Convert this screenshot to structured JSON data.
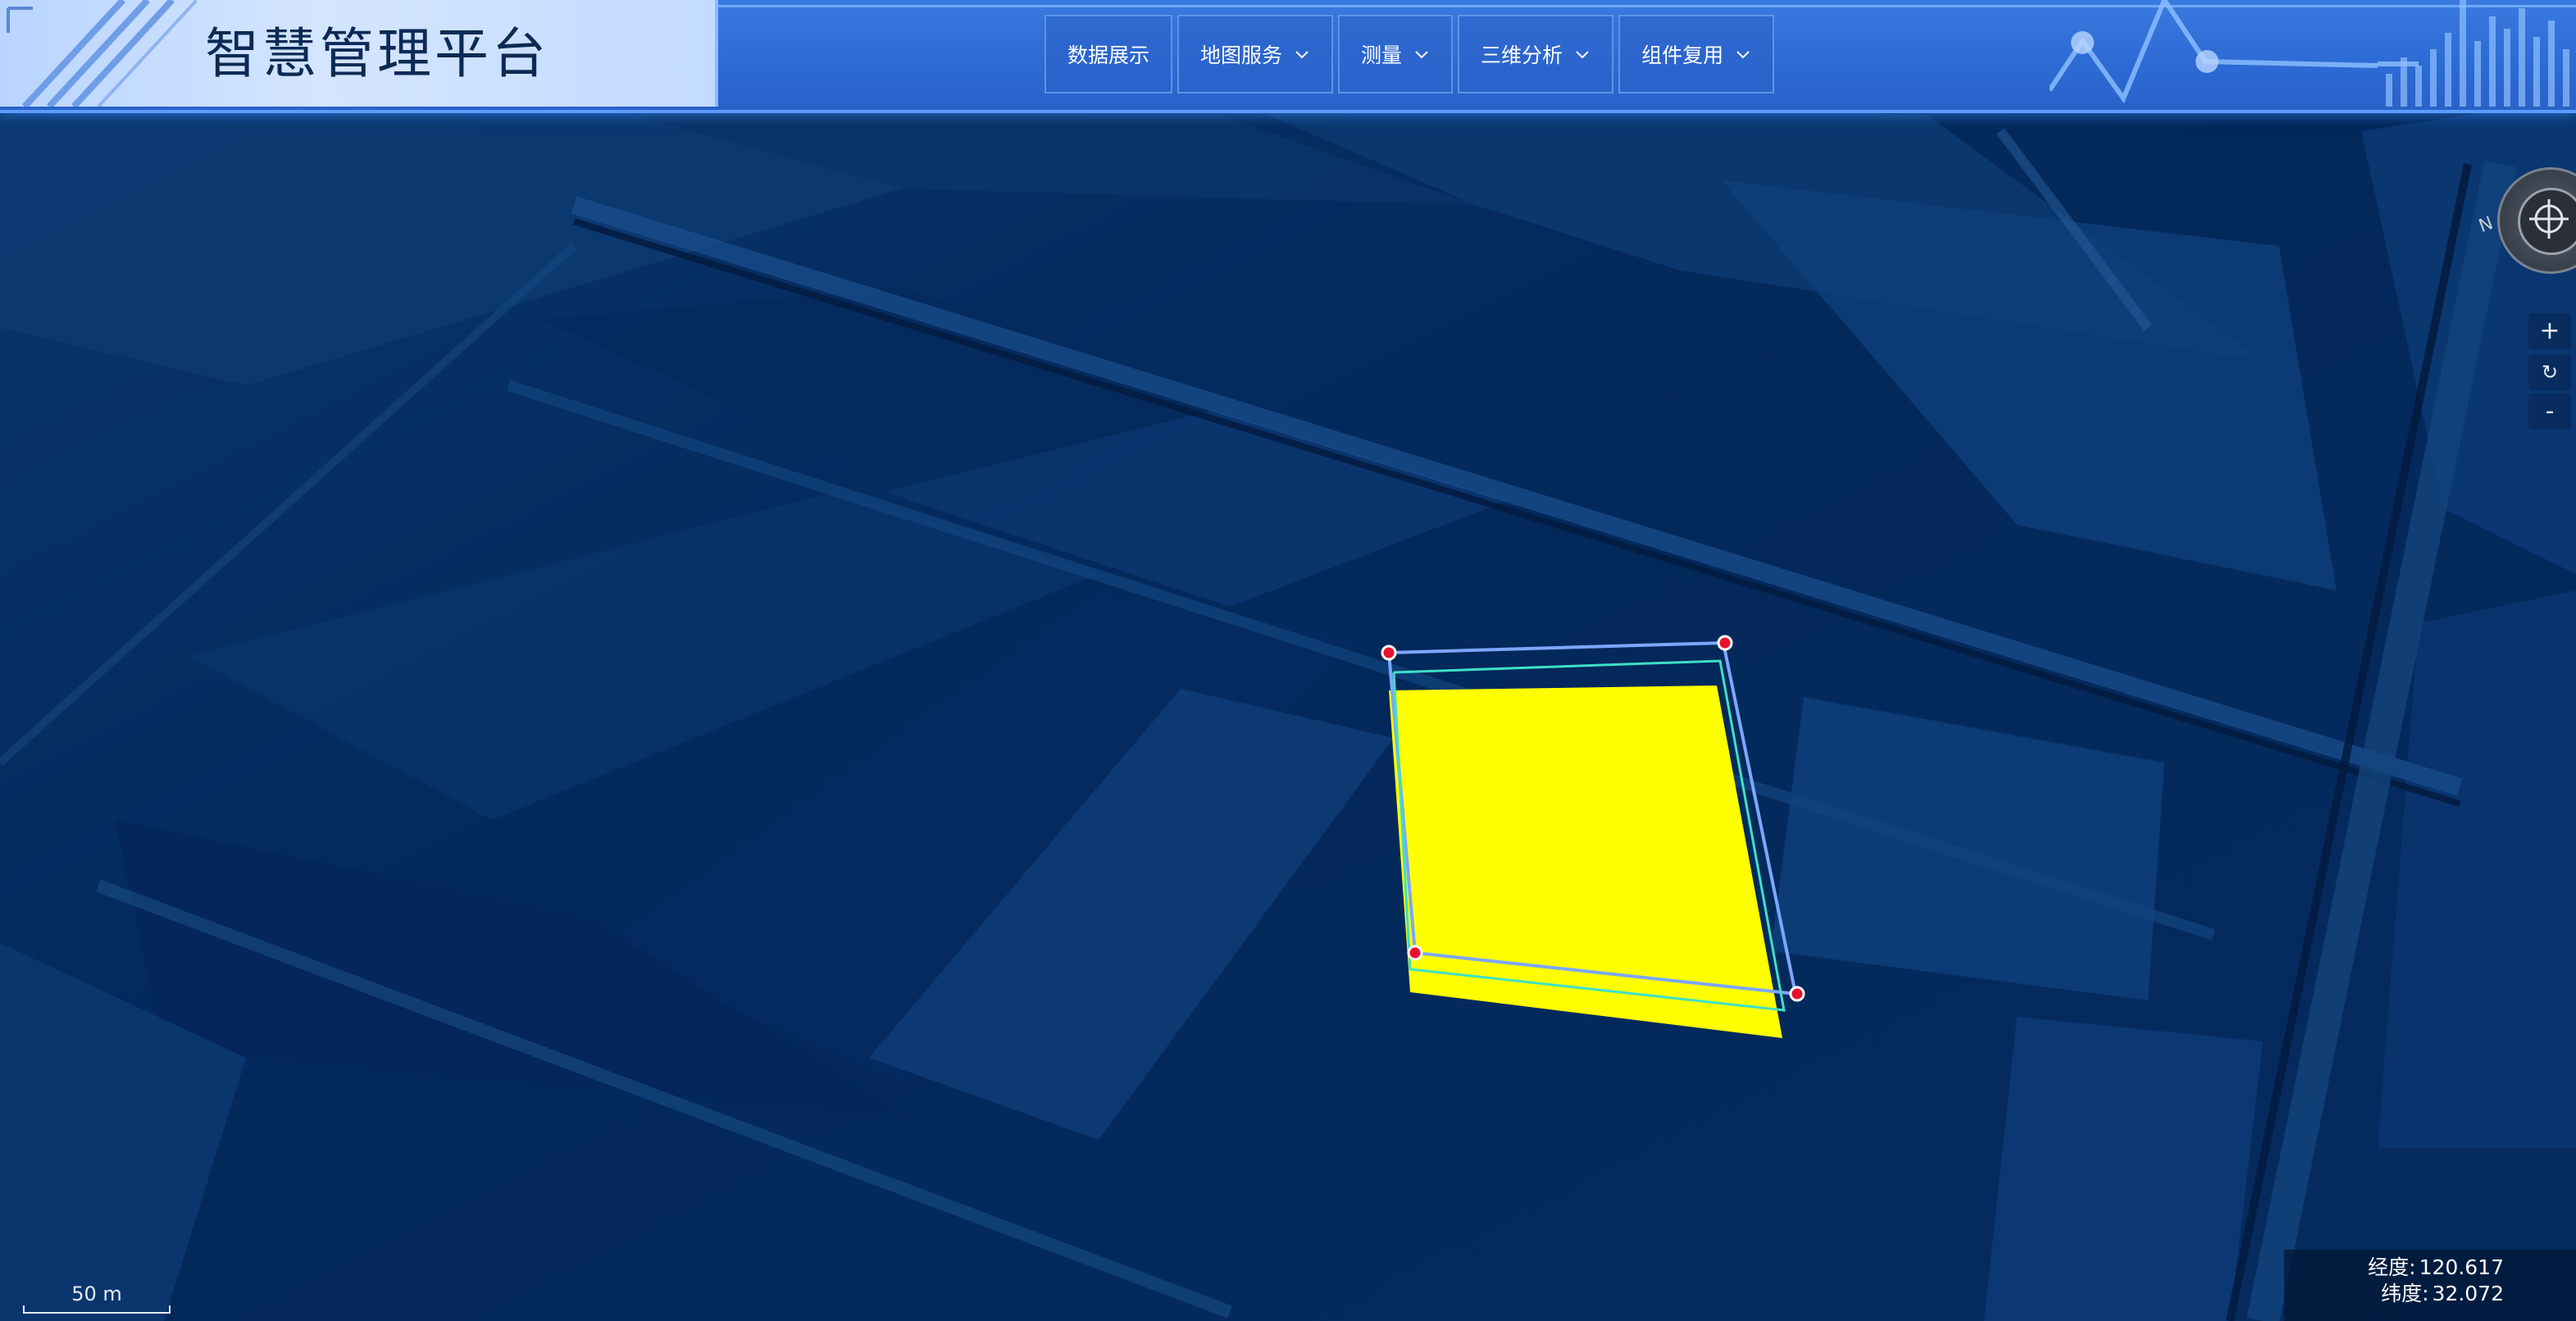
{
  "header": {
    "title": "智慧管理平台",
    "nav": [
      {
        "label": "数据展示",
        "has_dropdown": false
      },
      {
        "label": "地图服务",
        "has_dropdown": true
      },
      {
        "label": "测量",
        "has_dropdown": true
      },
      {
        "label": "三维分析",
        "has_dropdown": true
      },
      {
        "label": "组件复用",
        "has_dropdown": true
      }
    ]
  },
  "map": {
    "base_tint": "#022a5c",
    "polygon_fill": "#ffff00",
    "vertex_color": "#e8112d",
    "outline_colors": [
      "#7da6ff",
      "#3de0c8"
    ]
  },
  "controls": {
    "compass_label": "N",
    "zoom_in": "+",
    "reset": "↻",
    "zoom_out": "-"
  },
  "scale": {
    "label": "50 m"
  },
  "coordinates": {
    "lon_label": "经度:",
    "lon_value": "120.617",
    "lat_label": "纬度:",
    "lat_value": "32.072"
  }
}
